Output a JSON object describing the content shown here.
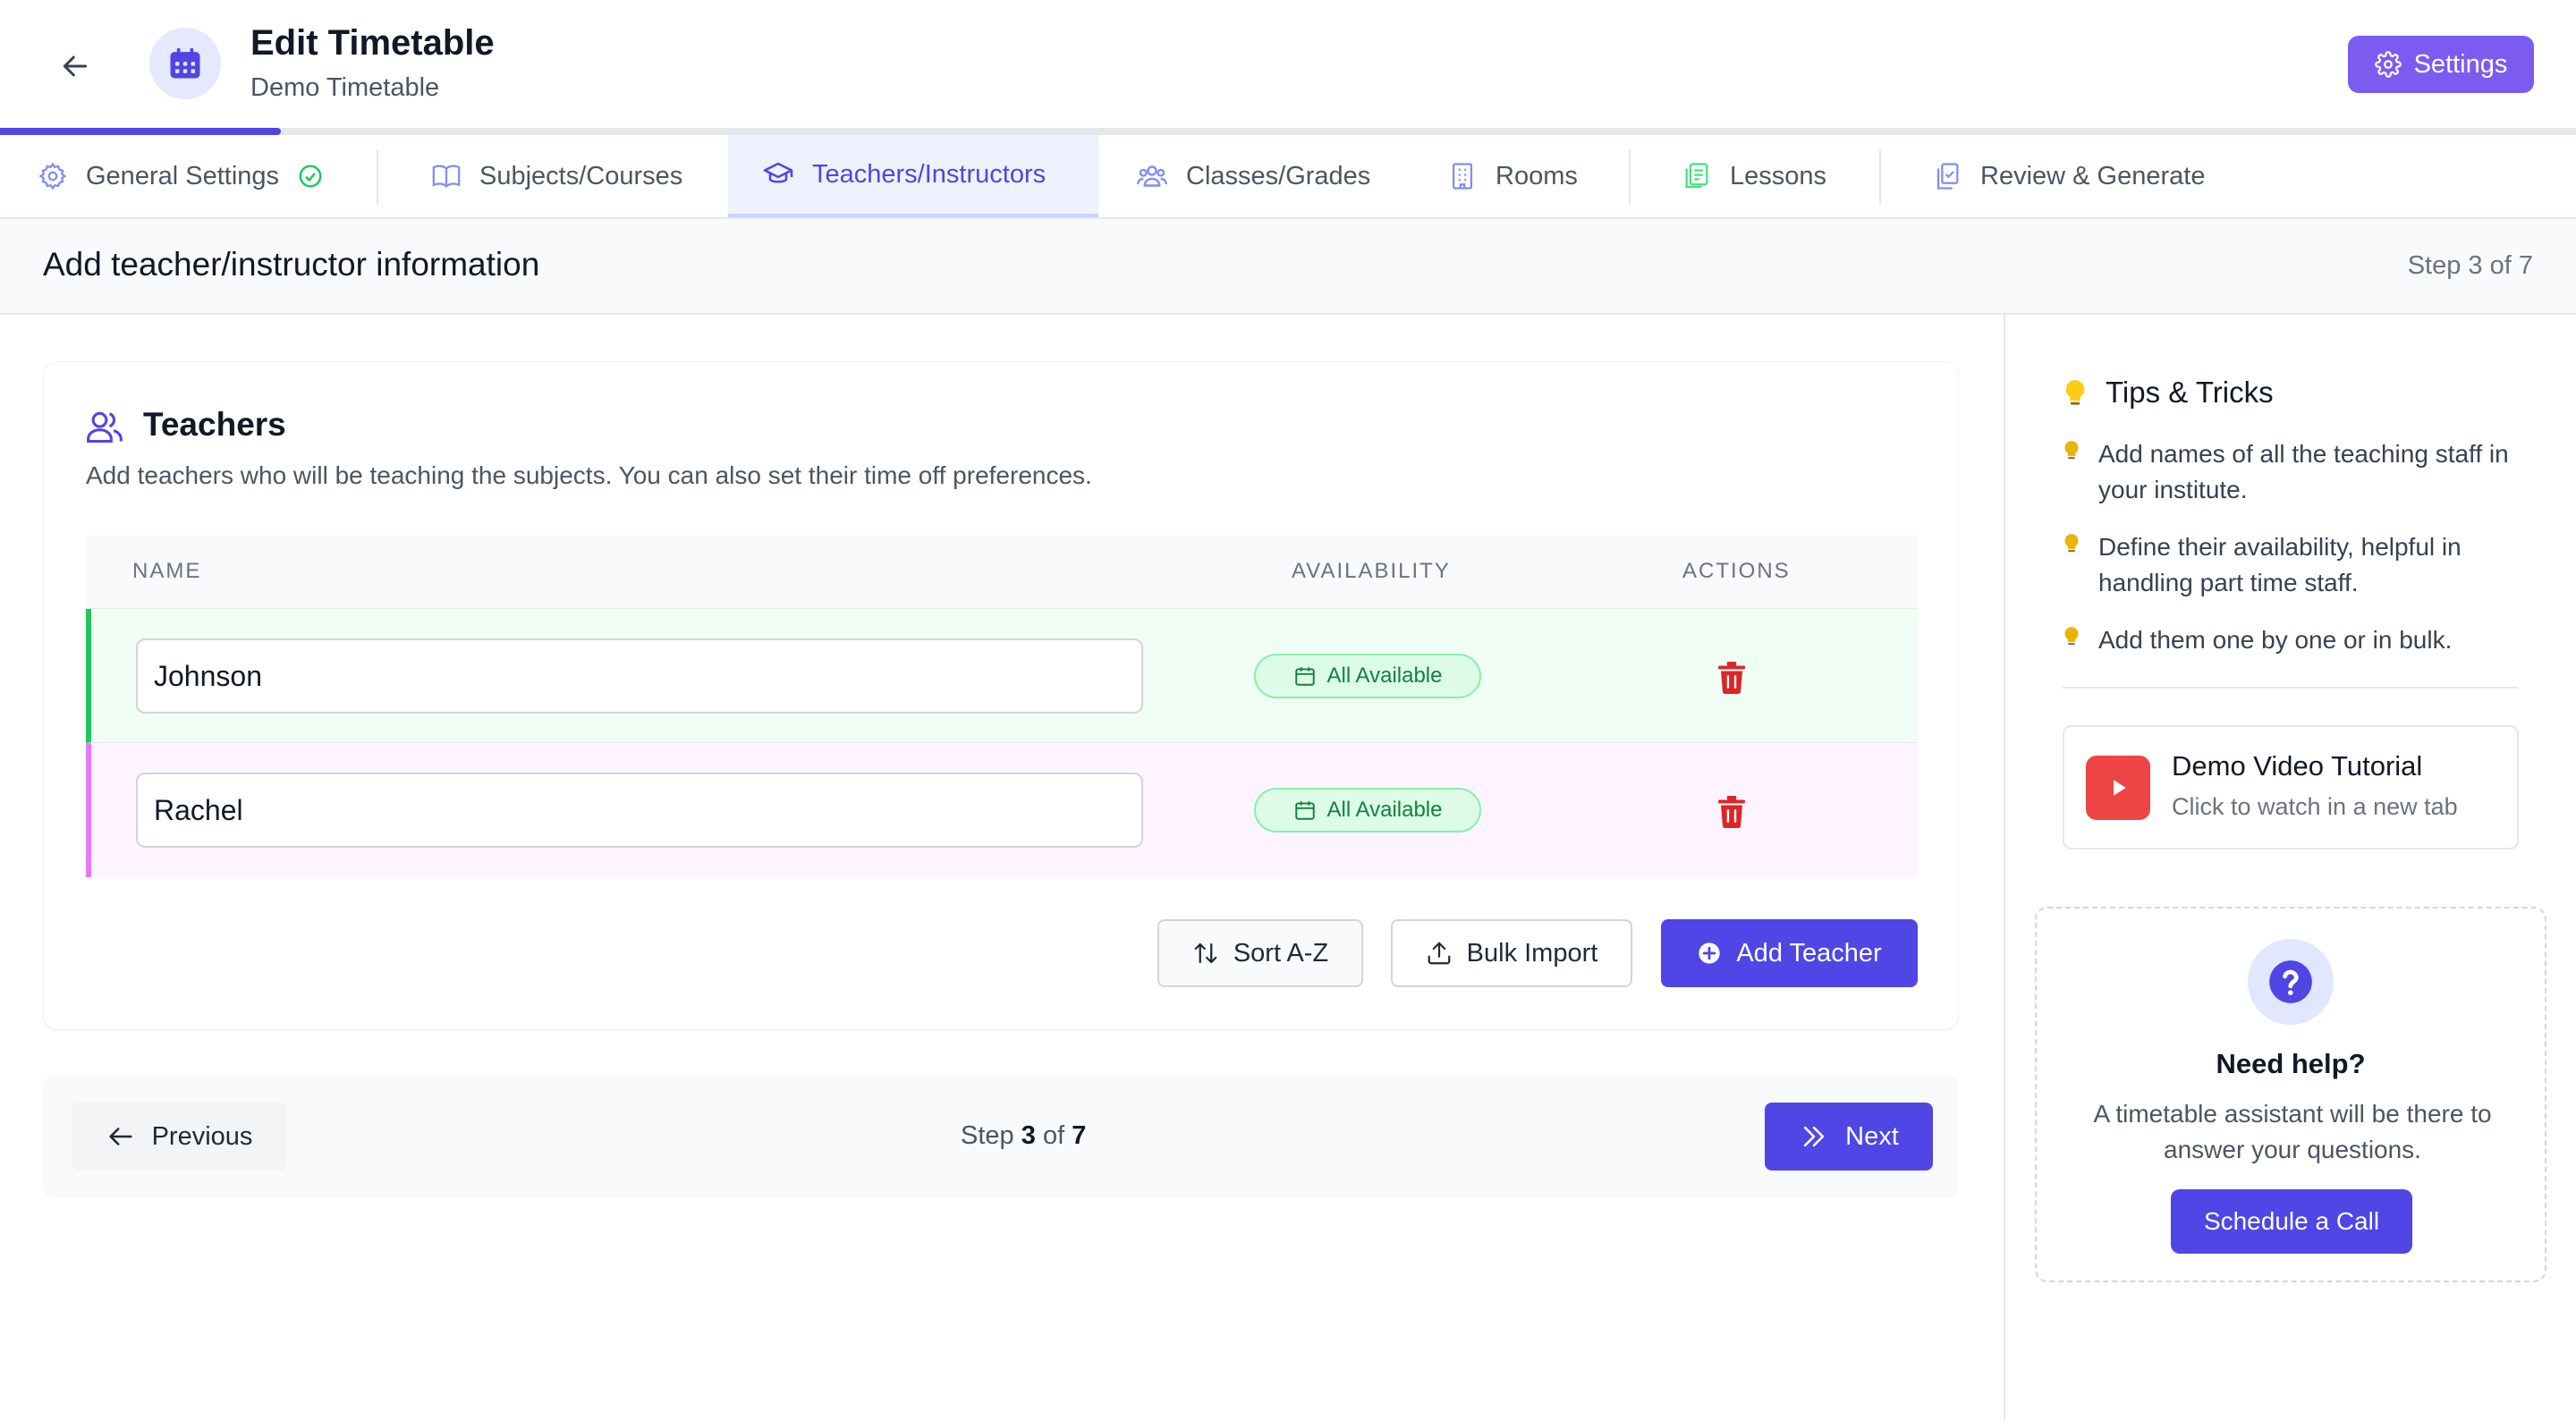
{
  "header": {
    "title": "Edit Timetable",
    "subtitle": "Demo Timetable",
    "settings_label": "Settings",
    "progress_fraction": 0.109
  },
  "tabs": [
    {
      "label": "General Settings",
      "icon": "gear-icon",
      "completed": true
    },
    {
      "label": "Subjects/Courses",
      "icon": "book-icon"
    },
    {
      "label": "Teachers/Instructors",
      "icon": "graduation-cap-icon",
      "active": true
    },
    {
      "label": "Classes/Grades",
      "icon": "users-icon"
    },
    {
      "label": "Rooms",
      "icon": "building-icon"
    },
    {
      "label": "Lessons",
      "icon": "clipboard-icon"
    },
    {
      "label": "Review & Generate",
      "icon": "copy-check-icon"
    }
  ],
  "stepbar": {
    "heading": "Add teacher/instructor information",
    "counter": "Step 3 of 7"
  },
  "teachers": {
    "title": "Teachers",
    "description": "Add teachers who will be teaching the subjects. You can also set their time off preferences.",
    "columns": {
      "name": "NAME",
      "availability": "AVAILABILITY",
      "actions": "ACTIONS"
    },
    "rows": [
      {
        "name": "Johnson",
        "availability": "All Available",
        "accent": "#22c55e",
        "bg": "#f0fdf4"
      },
      {
        "name": "Rachel",
        "availability": "All Available",
        "accent": "#e879f9",
        "bg": "#fdf4ff"
      }
    ],
    "sort_label": "Sort A-Z",
    "bulk_label": "Bulk Import",
    "add_label": "Add Teacher"
  },
  "nav": {
    "previous_label": "Previous",
    "step_word": "Step",
    "step_current": "3",
    "of_word": "of",
    "step_total": "7",
    "next_label": "Next"
  },
  "sidebar": {
    "tips_title": "Tips & Tricks",
    "tips": [
      "Add names of all the teaching staff in your institute.",
      "Define their availability, helpful in handling part time staff.",
      "Add them one by one or in bulk."
    ],
    "video_title": "Demo Video Tutorial",
    "video_subtitle": "Click to watch in a new tab",
    "help_title": "Need help?",
    "help_desc": "A timetable assistant will be there to answer your questions.",
    "call_label": "Schedule a Call"
  },
  "colors": {
    "primary": "#4f46e5",
    "settings_button": "#7c5cf0",
    "danger": "#dc2626",
    "success": "#22c55e"
  }
}
